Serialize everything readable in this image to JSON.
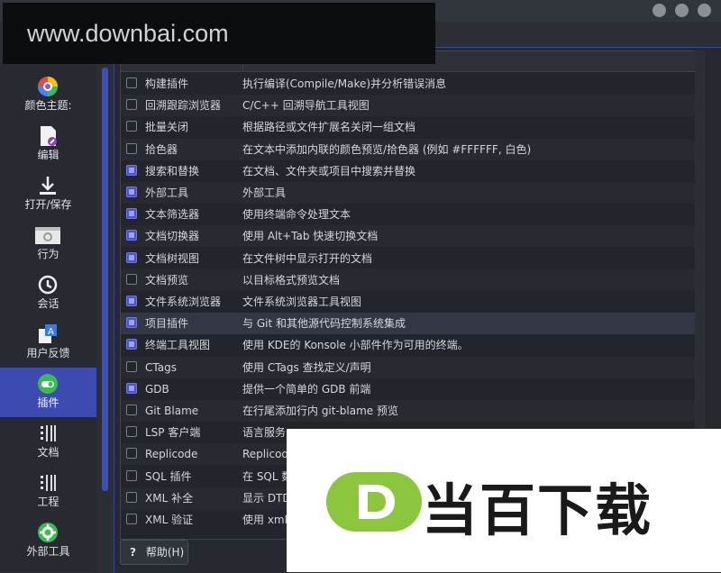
{
  "watermark_top": "www.downbai.com",
  "watermark_brand": "当百下载",
  "colors": {
    "accent": "#3d4ab0",
    "checkbox_on": "#4a54c4",
    "brand_green": "#8cc63f"
  },
  "sidebar": {
    "items": [
      {
        "label": "颜色主题:",
        "icon": "color-theme-icon"
      },
      {
        "label": "编辑",
        "icon": "edit-icon"
      },
      {
        "label": "打开/保存",
        "icon": "download-icon"
      },
      {
        "label": "行为",
        "icon": "behavior-icon"
      },
      {
        "label": "会话",
        "icon": "clock-icon"
      },
      {
        "label": "用户反馈",
        "icon": "feedback-icon"
      },
      {
        "label": "插件",
        "icon": "plugin-toggle-icon"
      },
      {
        "label": "文档",
        "icon": "document-icon"
      },
      {
        "label": "工程",
        "icon": "project-icon"
      },
      {
        "label": "外部工具",
        "icon": "gear-icon"
      }
    ]
  },
  "plugins": {
    "rows": [
      {
        "name": "构建插件",
        "desc": "执行编译(Compile/Make)并分析错误消息",
        "checked": false
      },
      {
        "name": "回溯跟踪浏览器",
        "desc": "C/C++ 回溯导航工具视图",
        "checked": false
      },
      {
        "name": "批量关闭",
        "desc": "根据路径或文件扩展名关闭一组文档",
        "checked": false
      },
      {
        "name": "拾色器",
        "desc": "在文本中添加内联的颜色预览/拾色器 (例如 #FFFFFF, 白色)",
        "checked": false
      },
      {
        "name": "搜索和替换",
        "desc": "在文档、文件夹或项目中搜索并替换",
        "checked": true
      },
      {
        "name": "外部工具",
        "desc": "外部工具",
        "checked": true
      },
      {
        "name": "文本筛选器",
        "desc": "使用终端命令处理文本",
        "checked": true
      },
      {
        "name": "文档切换器",
        "desc": "使用 Alt+Tab 快速切换文档",
        "checked": true
      },
      {
        "name": "文档树视图",
        "desc": "在文件树中显示打开的文档",
        "checked": true
      },
      {
        "name": "文档预览",
        "desc": "以目标格式预览文档",
        "checked": false
      },
      {
        "name": "文件系统浏览器",
        "desc": "文件系统浏览器工具视图",
        "checked": true
      },
      {
        "name": "项目插件",
        "desc": "与 Git 和其他源代码控制系统集成",
        "checked": true
      },
      {
        "name": "终端工具视图",
        "desc": "使用 KDE的 Konsole 小部件作为可用的终端。",
        "checked": true
      },
      {
        "name": "CTags",
        "desc": "使用 CTags 查找定义/声明",
        "checked": false
      },
      {
        "name": "GDB",
        "desc": "提供一个简单的 GDB 前端",
        "checked": true
      },
      {
        "name": "Git Blame",
        "desc": "在行尾添加行内 git-blame 预览",
        "checked": false
      },
      {
        "name": "LSP 客户端",
        "desc": "语言服务",
        "checked": false
      },
      {
        "name": "Replicode",
        "desc": "Replicod",
        "checked": false
      },
      {
        "name": "SQL 插件",
        "desc": "在 SQL 数",
        "checked": false
      },
      {
        "name": "XML 补全",
        "desc": "显示 DTD",
        "checked": false
      },
      {
        "name": "XML 验证",
        "desc": "使用 xml",
        "checked": false
      }
    ]
  },
  "help_button": {
    "label": "帮助(H)"
  }
}
